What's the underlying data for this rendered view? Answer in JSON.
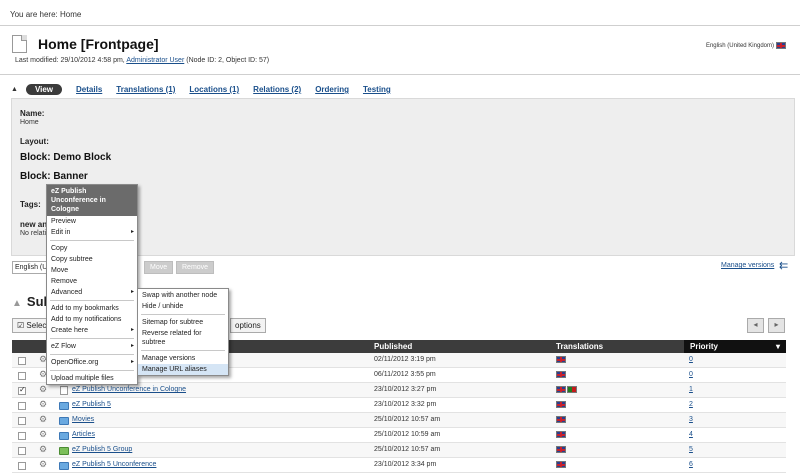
{
  "breadcrumb": {
    "prefix": "You are here:",
    "current": "Home"
  },
  "page": {
    "title": "Home [Frontpage]",
    "language": "English (United Kingdom)",
    "meta_prefix": "Last modified: 29/10/2012 4:58 pm,",
    "meta_author": "Administrator User",
    "meta_suffix": "(Node ID: 2, Object ID: 57)"
  },
  "tabs": [
    {
      "label": "View",
      "active": true
    },
    {
      "label": "Details"
    },
    {
      "label": "Translations (1)"
    },
    {
      "label": "Locations (1)"
    },
    {
      "label": "Relations (2)"
    },
    {
      "label": "Ordering"
    },
    {
      "label": "Testing"
    }
  ],
  "panel": {
    "name_label": "Name:",
    "name_value": "Home",
    "layout_label": "Layout:",
    "block1": "Block: Demo Block",
    "block2": "Block: Banner",
    "tags_label": "Tags:",
    "new_label": "new an",
    "no_relation": "No relati"
  },
  "controls": {
    "lang_select": "English (U",
    "move": "Move",
    "remove": "Remove",
    "manage_versions": "Manage versions"
  },
  "subitems": {
    "header": "Sub",
    "select_label": "Selec",
    "options_label": "options"
  },
  "table": {
    "headers": {
      "published": "Published",
      "translations": "Translations",
      "priority": "Priority"
    },
    "rows": [
      {
        "name": "",
        "published": "02/11/2012 3:19 pm",
        "priority": "0",
        "checked": false,
        "icon": "none",
        "flags": [
          "uk"
        ]
      },
      {
        "name": "",
        "published": "06/11/2012 3:55 pm",
        "priority": "0",
        "checked": false,
        "icon": "none",
        "flags": [
          "uk"
        ]
      },
      {
        "name": "eZ Publish Unconference in Cologne",
        "published": "23/10/2012 3:27 pm",
        "priority": "1",
        "checked": true,
        "icon": "doc",
        "flags": [
          "uk",
          "pt"
        ]
      },
      {
        "name": "eZ Publish 5",
        "published": "23/10/2012 3:32 pm",
        "priority": "2",
        "checked": false,
        "icon": "folder",
        "flags": [
          "uk"
        ]
      },
      {
        "name": "Movies",
        "published": "25/10/2012 10:57 am",
        "priority": "3",
        "checked": false,
        "icon": "folder",
        "flags": [
          "uk"
        ]
      },
      {
        "name": "Articles",
        "published": "25/10/2012 10:59 am",
        "priority": "4",
        "checked": false,
        "icon": "folder",
        "flags": [
          "uk"
        ]
      },
      {
        "name": "eZ Publish 5 Group",
        "published": "25/10/2012 10:57 am",
        "priority": "5",
        "checked": false,
        "icon": "group",
        "flags": [
          "uk"
        ]
      },
      {
        "name": "eZ Publish 5 Unconference",
        "published": "23/10/2012 3:34 pm",
        "priority": "6",
        "checked": false,
        "icon": "folder",
        "flags": [
          "uk"
        ]
      }
    ]
  },
  "context_menu": {
    "header": "eZ Publish Unconference in Cologne",
    "groups": [
      [
        {
          "label": "Preview"
        },
        {
          "label": "Edit in",
          "sub": true
        }
      ],
      [
        {
          "label": "Copy"
        },
        {
          "label": "Copy subtree"
        },
        {
          "label": "Move"
        },
        {
          "label": "Remove"
        },
        {
          "label": "Advanced",
          "sub": true
        }
      ],
      [
        {
          "label": "Add to my bookmarks"
        },
        {
          "label": "Add to my notifications"
        },
        {
          "label": "Create here",
          "sub": true
        }
      ],
      [
        {
          "label": "eZ Flow",
          "sub": true
        }
      ],
      [
        {
          "label": "OpenOffice.org",
          "sub": true
        }
      ],
      [
        {
          "label": "Upload multiple files"
        }
      ]
    ]
  },
  "submenu": {
    "groups": [
      [
        {
          "label": "Swap with another node"
        },
        {
          "label": "Hide / unhide"
        }
      ],
      [
        {
          "label": "Sitemap for subtree"
        },
        {
          "label": "Reverse related for subtree"
        }
      ],
      [
        {
          "label": "Manage versions"
        },
        {
          "label": "Manage URL aliases",
          "highlight": true
        }
      ]
    ]
  }
}
